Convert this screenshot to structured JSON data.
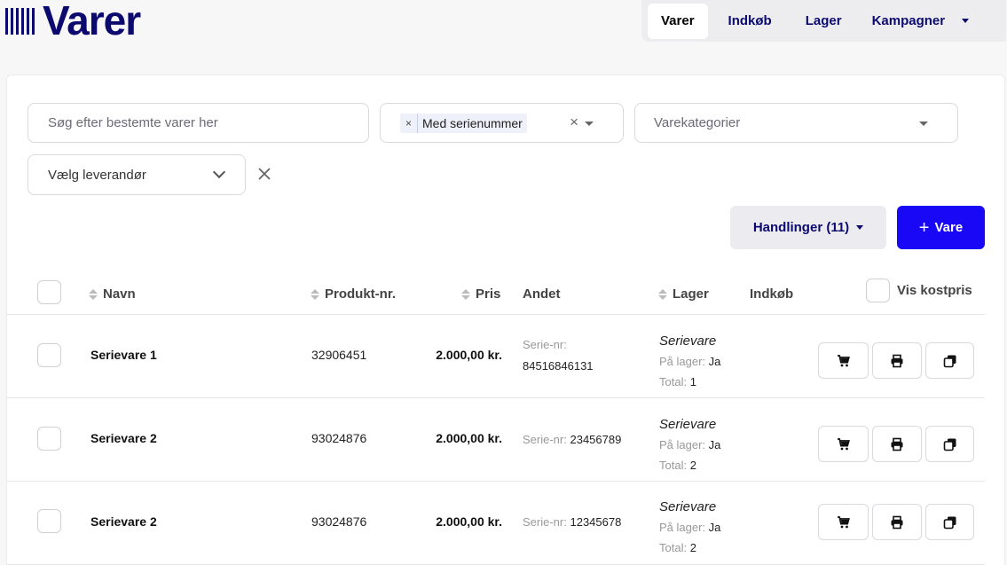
{
  "brand": {
    "title": "Varer"
  },
  "nav": {
    "tabs": [
      "Varer",
      "Indkøb",
      "Lager",
      "Kampagner"
    ],
    "active": "Varer"
  },
  "filters": {
    "search_placeholder": "Søg efter bestemte varer her",
    "tag_label": "Med serienummer",
    "tag_remove": "×",
    "tag_clear": "×",
    "category_placeholder": "Varekategorier",
    "supplier_placeholder": "Vælg leverandør"
  },
  "toolbar": {
    "actions_label": "Handlinger (11)",
    "add_plus": "+",
    "add_label": "Vare"
  },
  "table": {
    "headers": {
      "name": "Navn",
      "product_no": "Produkt-nr.",
      "price": "Pris",
      "other": "Andet",
      "stock": "Lager",
      "purchase": "Indkøb",
      "show_cost": "Vis kostpris"
    },
    "labels": {
      "serial": "Serie-nr:",
      "in_stock": "På lager:",
      "total": "Total:"
    },
    "rows": [
      {
        "name": "Serievare 1",
        "product_no": "32906451",
        "price": "2.000,00 kr.",
        "serial": "84516846131",
        "type": "Serievare",
        "in_stock": "Ja",
        "total": "1"
      },
      {
        "name": "Serievare 2",
        "product_no": "93024876",
        "price": "2.000,00 kr.",
        "serial": "23456789",
        "type": "Serievare",
        "in_stock": "Ja",
        "total": "2"
      },
      {
        "name": "Serievare 2",
        "product_no": "93024876",
        "price": "2.000,00 kr.",
        "serial": "12345678",
        "type": "Serievare",
        "in_stock": "Ja",
        "total": "2"
      }
    ]
  },
  "icons": {
    "row_actions": [
      "cart-icon",
      "printer-icon",
      "copy-icon"
    ]
  },
  "colors": {
    "brand": "#0c0a6e",
    "primary_button": "#1808f5"
  }
}
